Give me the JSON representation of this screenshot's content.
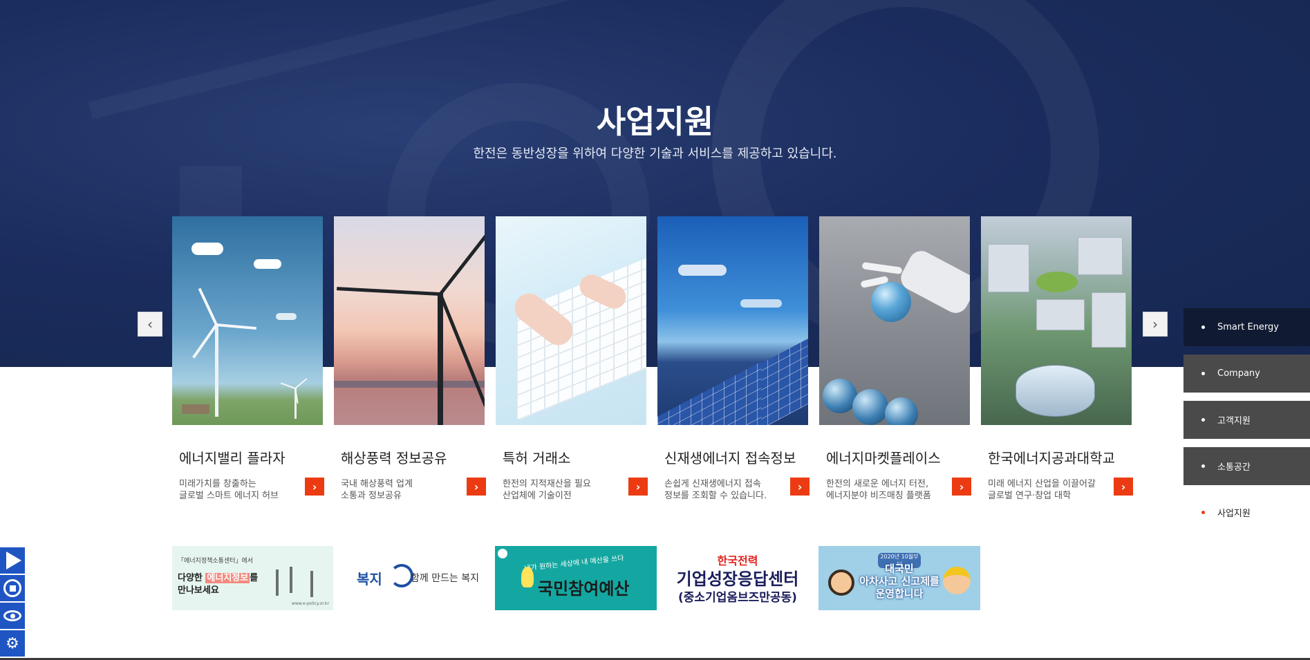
{
  "section": {
    "title": "사업지원",
    "subtitle": "한전은 동반성장을 위하여 다양한 기술과 서비스를 제공하고 있습니다."
  },
  "slider": {
    "prev_icon": "chevron-left-icon",
    "next_icon": "chevron-right-icon",
    "prev_glyph": "‹",
    "next_glyph": "›",
    "go_glyph": "›",
    "cards": [
      {
        "title": "에너지밸리 플라자",
        "desc_line1": "미래가치를 창출하는",
        "desc_line2": "글로벌 스마트 에너지 허브"
      },
      {
        "title": "해상풍력 정보공유",
        "desc_line1": "국내 해상풍력 업계",
        "desc_line2": "소통과 정보공유"
      },
      {
        "title": "특허 거래소",
        "desc_line1": "한전의 지적재산을 필요",
        "desc_line2": "산업체에 기술이전"
      },
      {
        "title": "신재생에너지 접속정보",
        "desc_line1": "손쉽게 신재생에너지 접속",
        "desc_line2": "정보를 조회할 수 있습니다."
      },
      {
        "title": "에너지마켓플레이스",
        "desc_line1": "한전의 새로운 에너지 터전,",
        "desc_line2": "에너지분야 비즈매칭 플랫폼"
      },
      {
        "title": "한국에너지공과대학교",
        "desc_line1": "미래 에너지 산업을 이끌어갈",
        "desc_line2": "글로벌 연구·창업 대학"
      }
    ]
  },
  "banners": {
    "b1": {
      "top": "「에너지정책소통센터」에서",
      "line1_pre": "다양한",
      "line1_hl": "에너지정보",
      "line1_post": "를",
      "line2": "만나보세요",
      "url": "www.e-policy.or.kr"
    },
    "b2": {
      "logo": "복지",
      "text": "함께 만드는 복지"
    },
    "b3": {
      "top": "내가 원하는 세상에 내 예산을 쓰다",
      "main": "국민참여예산"
    },
    "b4": {
      "brand": "한국전력",
      "main": "기업성장응답센터",
      "sub": "(중소기업옴브즈만공동)"
    },
    "b5": {
      "pill": "2020년 10월부터",
      "line1": "대국민",
      "line2": "아차사고 신고제를",
      "line3": "운영합니다"
    }
  },
  "sidenav": {
    "items": [
      {
        "label": "Smart Energy"
      },
      {
        "label": "Company"
      },
      {
        "label": "고객지원"
      },
      {
        "label": "소통공간"
      },
      {
        "label": "사업지원"
      }
    ]
  },
  "tools": {
    "items": [
      "play-icon",
      "stop-icon",
      "view-icon",
      "settings-icon"
    ],
    "gear_glyph": "⚙"
  },
  "colors": {
    "hero_bg": "#1b2d5e",
    "accent": "#ec3b12",
    "nav_dark": "#101b33",
    "nav_gray": "#4a4a4a",
    "tool_blue": "#1f55c3"
  }
}
